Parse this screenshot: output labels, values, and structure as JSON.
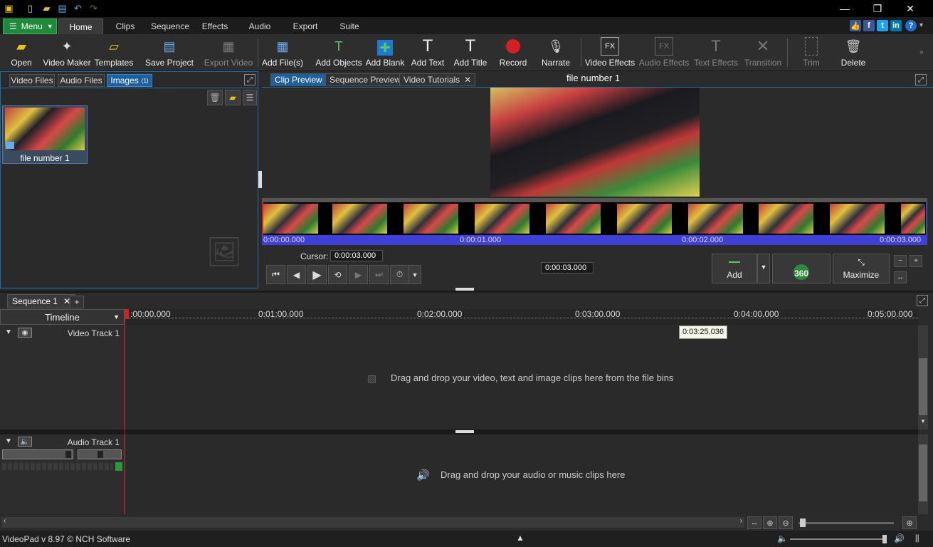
{
  "quick_access": {
    "icons": [
      "app-icon",
      "new-icon",
      "open-icon",
      "save-icon",
      "undo-icon",
      "redo-icon"
    ]
  },
  "menubar": {
    "menu_label": "Menu",
    "tabs": [
      "Home",
      "Clips",
      "Sequence",
      "Effects",
      "Audio",
      "Export",
      "Suite"
    ],
    "active_tab": "Home"
  },
  "toolbar": {
    "open": "Open",
    "video_maker": "Video Maker",
    "templates": "Templates",
    "save_project": "Save Project",
    "export_video": "Export Video",
    "add_files": "Add File(s)",
    "add_objects": "Add Objects",
    "add_blank": "Add Blank",
    "add_text": "Add Text",
    "add_title": "Add Title",
    "record": "Record",
    "narrate": "Narrate",
    "video_effects": "Video Effects",
    "audio_effects": "Audio Effects",
    "text_effects": "Text Effects",
    "transition": "Transition",
    "trim": "Trim",
    "delete": "Delete",
    "colors": {
      "record": "#d32020",
      "add_blank": "#1a7ad4"
    }
  },
  "bins": {
    "tabs": [
      "Video Files",
      "Audio Files",
      "Images"
    ],
    "images_count": "(1)",
    "active_tab": "Images",
    "items": [
      {
        "label": "file number 1"
      }
    ]
  },
  "preview": {
    "tabs": [
      "Clip Preview",
      "Sequence Preview",
      "Video Tutorials"
    ],
    "active_tab": "Clip Preview",
    "title": "file number 1",
    "strip_times": [
      "0:00:00.000",
      "0:00:01.000",
      "0:00:02.000",
      "0:00:03.000"
    ],
    "cursor_label": "Cursor:",
    "cursor_value": "0:00:03.000",
    "duration_value": "0:00:03.000",
    "add_label": "Add",
    "btn_360": "360",
    "maximize": "Maximize"
  },
  "sequence": {
    "tab_label": "Sequence 1",
    "add_tab": "+",
    "timeline_label": "Timeline",
    "ruler": [
      ":00:00.000",
      "0:01:00.000",
      "0:02:00.000",
      "0:03:00.000",
      "0:04:00.000",
      "0:05:00.000"
    ],
    "hover_time": "0:03:25.036",
    "video_track": "Video Track 1",
    "audio_track": "Audio Track 1",
    "video_drop_hint": "Drag and drop your video, text and image clips here from the file bins",
    "audio_drop_hint": "Drag and drop your audio or music clips here"
  },
  "status": {
    "version": "VideoPad v 8.97 © NCH Software"
  }
}
